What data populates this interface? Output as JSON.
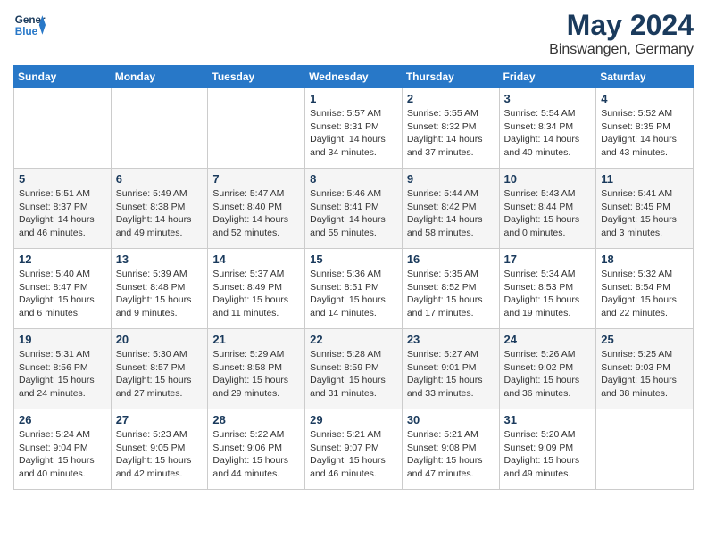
{
  "header": {
    "logo_line1": "General",
    "logo_line2": "Blue",
    "month": "May 2024",
    "location": "Binswangen, Germany"
  },
  "weekdays": [
    "Sunday",
    "Monday",
    "Tuesday",
    "Wednesday",
    "Thursday",
    "Friday",
    "Saturday"
  ],
  "weeks": [
    [
      {
        "day": "",
        "info": ""
      },
      {
        "day": "",
        "info": ""
      },
      {
        "day": "",
        "info": ""
      },
      {
        "day": "1",
        "info": "Sunrise: 5:57 AM\nSunset: 8:31 PM\nDaylight: 14 hours and 34 minutes."
      },
      {
        "day": "2",
        "info": "Sunrise: 5:55 AM\nSunset: 8:32 PM\nDaylight: 14 hours and 37 minutes."
      },
      {
        "day": "3",
        "info": "Sunrise: 5:54 AM\nSunset: 8:34 PM\nDaylight: 14 hours and 40 minutes."
      },
      {
        "day": "4",
        "info": "Sunrise: 5:52 AM\nSunset: 8:35 PM\nDaylight: 14 hours and 43 minutes."
      }
    ],
    [
      {
        "day": "5",
        "info": "Sunrise: 5:51 AM\nSunset: 8:37 PM\nDaylight: 14 hours and 46 minutes."
      },
      {
        "day": "6",
        "info": "Sunrise: 5:49 AM\nSunset: 8:38 PM\nDaylight: 14 hours and 49 minutes."
      },
      {
        "day": "7",
        "info": "Sunrise: 5:47 AM\nSunset: 8:40 PM\nDaylight: 14 hours and 52 minutes."
      },
      {
        "day": "8",
        "info": "Sunrise: 5:46 AM\nSunset: 8:41 PM\nDaylight: 14 hours and 55 minutes."
      },
      {
        "day": "9",
        "info": "Sunrise: 5:44 AM\nSunset: 8:42 PM\nDaylight: 14 hours and 58 minutes."
      },
      {
        "day": "10",
        "info": "Sunrise: 5:43 AM\nSunset: 8:44 PM\nDaylight: 15 hours and 0 minutes."
      },
      {
        "day": "11",
        "info": "Sunrise: 5:41 AM\nSunset: 8:45 PM\nDaylight: 15 hours and 3 minutes."
      }
    ],
    [
      {
        "day": "12",
        "info": "Sunrise: 5:40 AM\nSunset: 8:47 PM\nDaylight: 15 hours and 6 minutes."
      },
      {
        "day": "13",
        "info": "Sunrise: 5:39 AM\nSunset: 8:48 PM\nDaylight: 15 hours and 9 minutes."
      },
      {
        "day": "14",
        "info": "Sunrise: 5:37 AM\nSunset: 8:49 PM\nDaylight: 15 hours and 11 minutes."
      },
      {
        "day": "15",
        "info": "Sunrise: 5:36 AM\nSunset: 8:51 PM\nDaylight: 15 hours and 14 minutes."
      },
      {
        "day": "16",
        "info": "Sunrise: 5:35 AM\nSunset: 8:52 PM\nDaylight: 15 hours and 17 minutes."
      },
      {
        "day": "17",
        "info": "Sunrise: 5:34 AM\nSunset: 8:53 PM\nDaylight: 15 hours and 19 minutes."
      },
      {
        "day": "18",
        "info": "Sunrise: 5:32 AM\nSunset: 8:54 PM\nDaylight: 15 hours and 22 minutes."
      }
    ],
    [
      {
        "day": "19",
        "info": "Sunrise: 5:31 AM\nSunset: 8:56 PM\nDaylight: 15 hours and 24 minutes."
      },
      {
        "day": "20",
        "info": "Sunrise: 5:30 AM\nSunset: 8:57 PM\nDaylight: 15 hours and 27 minutes."
      },
      {
        "day": "21",
        "info": "Sunrise: 5:29 AM\nSunset: 8:58 PM\nDaylight: 15 hours and 29 minutes."
      },
      {
        "day": "22",
        "info": "Sunrise: 5:28 AM\nSunset: 8:59 PM\nDaylight: 15 hours and 31 minutes."
      },
      {
        "day": "23",
        "info": "Sunrise: 5:27 AM\nSunset: 9:01 PM\nDaylight: 15 hours and 33 minutes."
      },
      {
        "day": "24",
        "info": "Sunrise: 5:26 AM\nSunset: 9:02 PM\nDaylight: 15 hours and 36 minutes."
      },
      {
        "day": "25",
        "info": "Sunrise: 5:25 AM\nSunset: 9:03 PM\nDaylight: 15 hours and 38 minutes."
      }
    ],
    [
      {
        "day": "26",
        "info": "Sunrise: 5:24 AM\nSunset: 9:04 PM\nDaylight: 15 hours and 40 minutes."
      },
      {
        "day": "27",
        "info": "Sunrise: 5:23 AM\nSunset: 9:05 PM\nDaylight: 15 hours and 42 minutes."
      },
      {
        "day": "28",
        "info": "Sunrise: 5:22 AM\nSunset: 9:06 PM\nDaylight: 15 hours and 44 minutes."
      },
      {
        "day": "29",
        "info": "Sunrise: 5:21 AM\nSunset: 9:07 PM\nDaylight: 15 hours and 46 minutes."
      },
      {
        "day": "30",
        "info": "Sunrise: 5:21 AM\nSunset: 9:08 PM\nDaylight: 15 hours and 47 minutes."
      },
      {
        "day": "31",
        "info": "Sunrise: 5:20 AM\nSunset: 9:09 PM\nDaylight: 15 hours and 49 minutes."
      },
      {
        "day": "",
        "info": ""
      }
    ]
  ]
}
